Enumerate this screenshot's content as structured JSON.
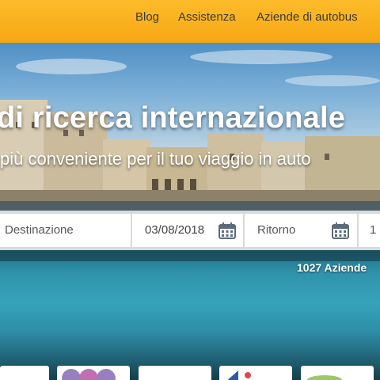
{
  "nav": {
    "blog": "Blog",
    "help": "Assistenza",
    "companies": "Aziende di autobus"
  },
  "hero": {
    "title": "di ricerca internazionale",
    "subtitle": "più conveniente per il tuo viaggio in auto"
  },
  "search": {
    "destination_placeholder": "Destinazione",
    "departure_date": "03/08/2018",
    "return_placeholder": "Ritorno",
    "passengers": "1"
  },
  "stats": {
    "companies_count": "1027 Aziende"
  },
  "colors": {
    "nav_background": "#fdbb2a",
    "nav_text": "#3a3a3a",
    "calendar_icon": "#5b6b7a"
  },
  "icons": {
    "calendar": "calendar-icon"
  }
}
